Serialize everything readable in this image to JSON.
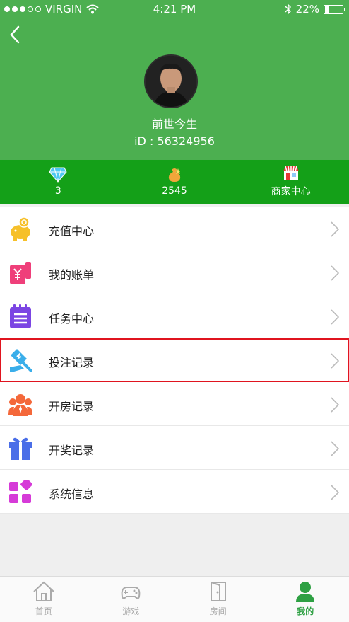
{
  "status_bar": {
    "carrier": "VIRGIN",
    "time": "4:21 PM",
    "battery": "22%",
    "battery_level": 0.22
  },
  "profile": {
    "username": "前世今生",
    "id_text": "iD : 56324956"
  },
  "stats": [
    {
      "icon": "diamond-icon",
      "value": "3"
    },
    {
      "icon": "coin-bag-icon",
      "value": "2545"
    },
    {
      "icon": "store-icon",
      "value": "商家中心"
    }
  ],
  "menu": [
    {
      "icon": "piggy-bank-icon",
      "label": "充值中心",
      "color": "#f6c02a"
    },
    {
      "icon": "bill-icon",
      "label": "我的账单",
      "color": "#ef3f7a"
    },
    {
      "icon": "task-list-icon",
      "label": "任务中心",
      "color": "#7b45e3"
    },
    {
      "icon": "gavel-icon",
      "label": "投注记录",
      "color": "#3aaeea",
      "highlighted": true
    },
    {
      "icon": "group-icon",
      "label": "开房记录",
      "color": "#f4683a"
    },
    {
      "icon": "gift-icon",
      "label": "开奖记录",
      "color": "#4a6ee8"
    },
    {
      "icon": "system-grid-icon",
      "label": "系统信息",
      "color": "#d63bd8"
    }
  ],
  "tabs": [
    {
      "icon": "home-icon",
      "label": "首页",
      "active": false
    },
    {
      "icon": "gamepad-icon",
      "label": "游戏",
      "active": false
    },
    {
      "icon": "door-icon",
      "label": "房间",
      "active": false
    },
    {
      "icon": "user-icon",
      "label": "我的",
      "active": true
    }
  ],
  "colors": {
    "header": "#4caf50",
    "stats_bar": "#14a018",
    "active_tab": "#2ea043",
    "highlight_border": "#e0141f"
  }
}
